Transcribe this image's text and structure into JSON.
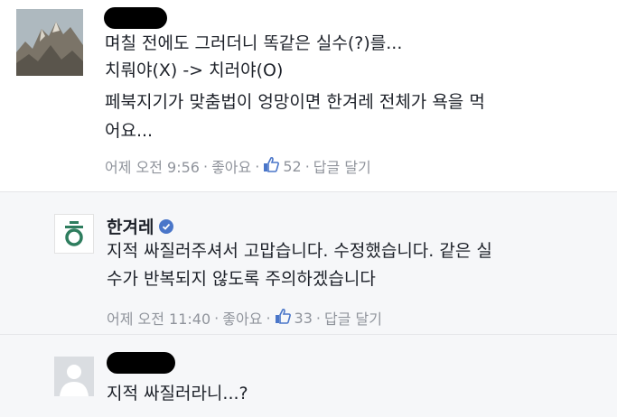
{
  "comments": [
    {
      "lines": [
        "며칠 전에도 그러더니 똑같은 실수(?)를...",
        "치뤄야(X) -> 치러야(O)",
        "페북지기가 맞춤법이 엉망이면 한겨레 전체가 욕을 먹",
        "어요..."
      ],
      "time": "어제 오전 9:56",
      "like_label": "좋아요",
      "like_count": "52",
      "reply_label": "답글 달기"
    },
    {
      "author": "한겨레",
      "lines": [
        "지적 싸질러주셔서 고맙습니다. 수정했습니다. 같은 실",
        "수가 반복되지 않도록 주의하겠습니다"
      ],
      "time": "어제 오전 11:40",
      "like_label": "좋아요",
      "like_count": "33",
      "reply_label": "답글 달기"
    },
    {
      "lines": [
        "지적 싸질러라니...?"
      ]
    }
  ],
  "meta_separator": "·",
  "colors": {
    "text": "#1d2129",
    "meta": "#90949c",
    "reply_bg": "#f6f7f9",
    "verified": "#4a76c9",
    "like_icon": "#4a76c9",
    "logo_green": "#2e7d5e"
  }
}
